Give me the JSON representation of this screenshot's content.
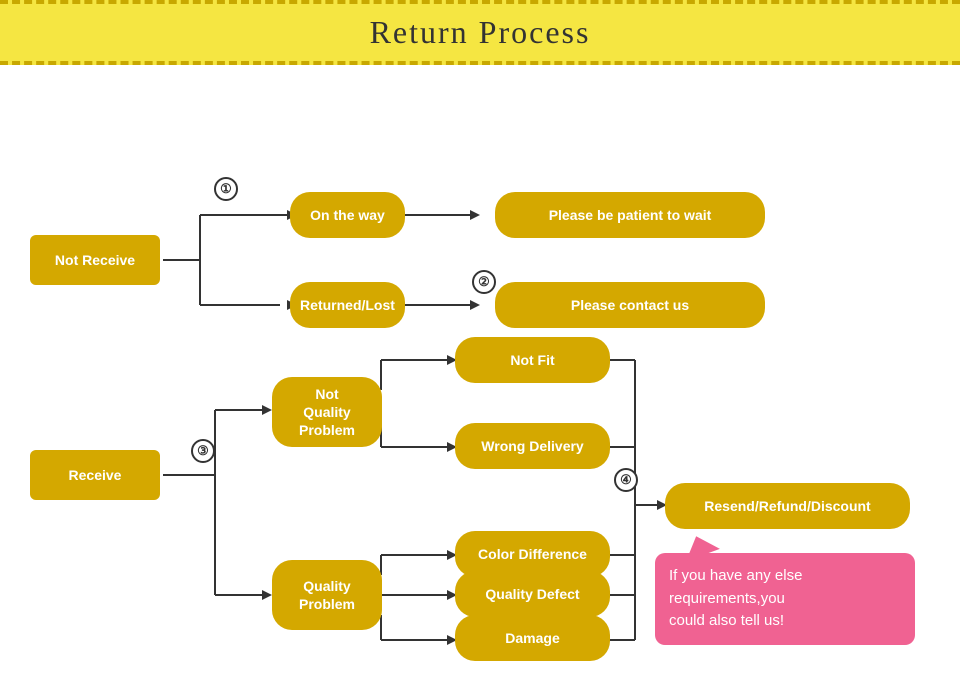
{
  "header": {
    "title": "Return Process"
  },
  "nodes": {
    "not_receive": {
      "label": "Not Receive"
    },
    "receive": {
      "label": "Receive"
    },
    "on_the_way": {
      "label": "On the way"
    },
    "returned_lost": {
      "label": "Returned/Lost"
    },
    "please_wait": {
      "label": "Please be patient to wait"
    },
    "please_contact": {
      "label": "Please contact us"
    },
    "not_quality_problem": {
      "label": "Not\nQuality\nProblem"
    },
    "quality_problem": {
      "label": "Quality\nProblem"
    },
    "not_fit": {
      "label": "Not Fit"
    },
    "wrong_delivery": {
      "label": "Wrong Delivery"
    },
    "color_difference": {
      "label": "Color Difference"
    },
    "quality_defect": {
      "label": "Quality Defect"
    },
    "damage": {
      "label": "Damage"
    },
    "resend_refund": {
      "label": "Resend/Refund/Discount"
    }
  },
  "circles": {
    "c1": "①",
    "c2": "②",
    "c3": "③",
    "c4": "④"
  },
  "bubble": {
    "text": "If you have any else\nrequirements,you\ncould also tell us!"
  }
}
